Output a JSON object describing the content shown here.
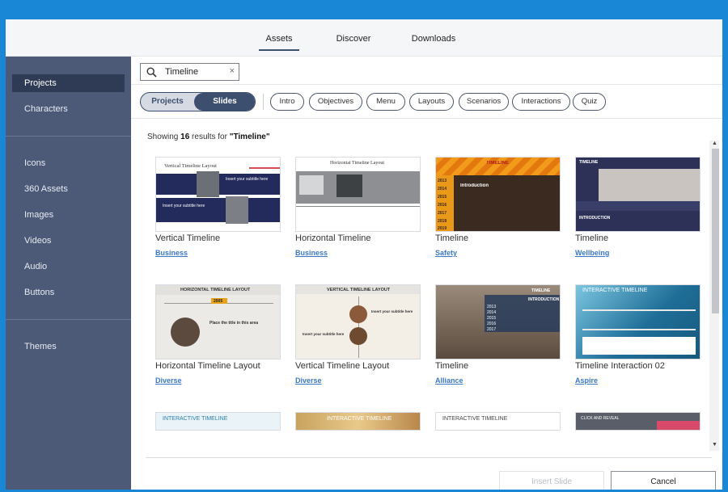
{
  "tabs": [
    "Assets",
    "Discover",
    "Downloads"
  ],
  "sidebar": {
    "primary": [
      "Projects",
      "Characters"
    ],
    "assets": [
      "Icons",
      "360 Assets",
      "Images",
      "Videos",
      "Audio",
      "Buttons"
    ],
    "extra": [
      "Themes"
    ]
  },
  "search": {
    "value": "Timeline",
    "clear": "×"
  },
  "toggle": {
    "projects": "Projects",
    "slides": "Slides"
  },
  "filters": [
    "Intro",
    "Objectives",
    "Menu",
    "Layouts",
    "Scenarios",
    "Interactions",
    "Quiz"
  ],
  "results": {
    "prefix": "Showing",
    "count": "16",
    "middle": "results for",
    "query": "\"Timeline\""
  },
  "cards": [
    {
      "title": "Vertical Timeline",
      "tag": "Business"
    },
    {
      "title": "Horizontal Timeline",
      "tag": "Business"
    },
    {
      "title": "Timeline",
      "tag": "Safety"
    },
    {
      "title": "Timeline",
      "tag": "Wellbeing"
    },
    {
      "title": "Horizontal Timeline Layout",
      "tag": "Diverse"
    },
    {
      "title": "Vertical Timeline Layout",
      "tag": "Diverse"
    },
    {
      "title": "Timeline",
      "tag": "Alliance"
    },
    {
      "title": "Timeline Interaction 02",
      "tag": "Aspire"
    }
  ],
  "thumbs": {
    "t1": {
      "heading": "Vertical Timeline Layout",
      "sub1": "Insert your subtitle here",
      "sub2": "Insert your subtitle here"
    },
    "t2": {
      "heading": "Horizontal Timeline Layout"
    },
    "t3": {
      "heading": "TIMELINE",
      "intro": "Introduction",
      "years": [
        "2013",
        "2014",
        "2015",
        "2016",
        "2017",
        "2018",
        "2019"
      ]
    },
    "t4": {
      "heading": "TIMELINE",
      "intro": "INTRODUCTION"
    },
    "t5": {
      "heading": "HORIZONTAL TIMELINE LAYOUT",
      "year": "2005",
      "body": "Place the title in this area"
    },
    "t6": {
      "heading": "VERTICAL TIMELINE LAYOUT",
      "sub1": "Insert your subtitle here",
      "sub2": "Insert your subtitle here"
    },
    "t7": {
      "heading": "TIMELINE",
      "intro": "INTRODUCTION",
      "years": [
        "2013",
        "2014",
        "2015",
        "2016",
        "2017"
      ]
    },
    "t8": {
      "heading": "INTERACTIVE TIMELINE"
    },
    "p1": {
      "heading": "INTERACTIVE TIMELINE"
    },
    "p2": {
      "heading": "INTERACTIVE TIMELINE"
    },
    "p3": {
      "heading": "INTERACTIVE TIMELINE"
    },
    "p4": {
      "heading": "CLICK AND REVEAL"
    }
  },
  "buttons": {
    "insert": "Insert Slide",
    "cancel": "Cancel"
  },
  "colors": {
    "frame": "#1a86d6",
    "sidebar": "#4c5a78",
    "sidebar_active": "#2f3b55",
    "accent": "#3d4f6e",
    "link": "#3b78c4"
  }
}
